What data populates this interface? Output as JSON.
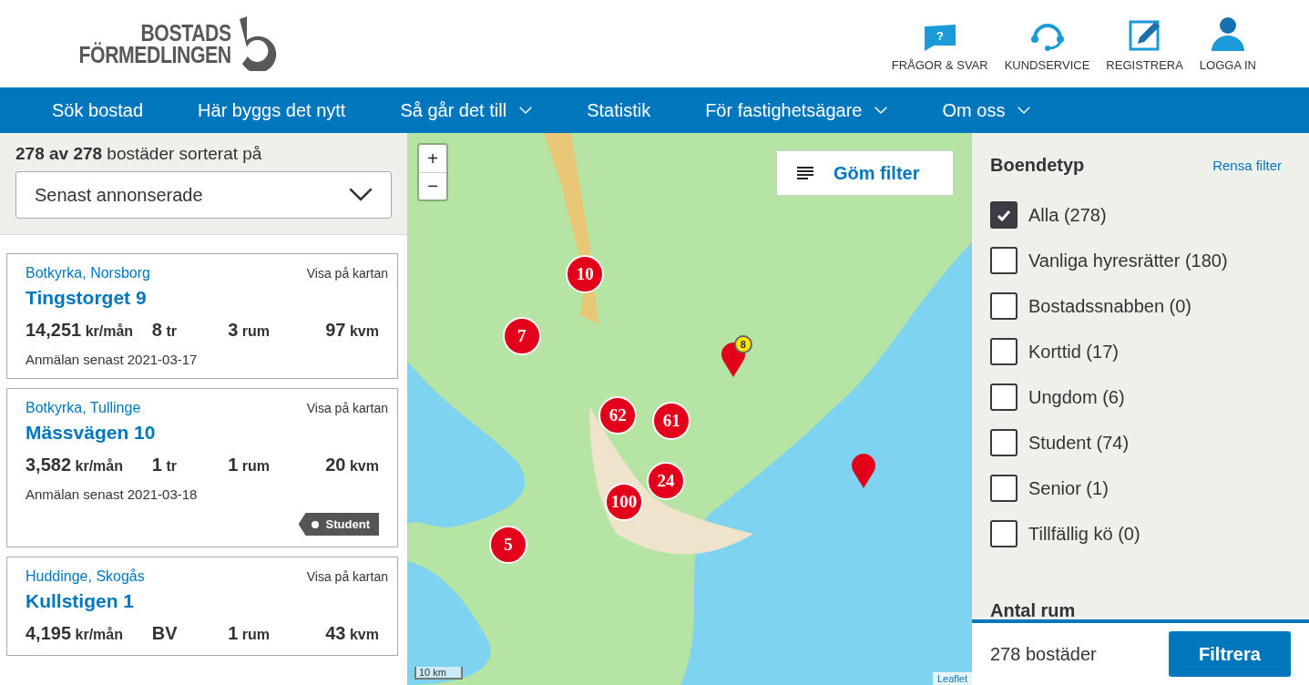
{
  "logo": {
    "lines": [
      "BOSTADS",
      "FÖRMEDLINGEN"
    ]
  },
  "top_links": [
    {
      "kind": "faq",
      "label": "FRÅGOR & SVAR",
      "icon_text": "?"
    },
    {
      "kind": "support",
      "label": "KUNDSERVICE"
    },
    {
      "kind": "register",
      "label": "REGISTRERA"
    },
    {
      "kind": "login",
      "label": "LOGGA IN"
    }
  ],
  "nav": [
    {
      "label": "Sök bostad",
      "has_menu": false
    },
    {
      "label": "Här byggs det nytt",
      "has_menu": false
    },
    {
      "label": "Så går det till",
      "has_menu": true
    },
    {
      "label": "Statistik",
      "has_menu": false
    },
    {
      "label": "För fastighetsägare",
      "has_menu": true
    },
    {
      "label": "Om oss",
      "has_menu": true
    }
  ],
  "results": {
    "summary": "**278 av 278** bostäder sorterat på",
    "sort": "Senast annonserade"
  },
  "listings": [
    {
      "area": "Botkyrka, Norsborg",
      "title": "Tingstorget 9",
      "map_link": "Visa på kartan",
      "stats": [
        {
          "value": "14,251",
          "unit": "kr/mån"
        },
        {
          "value": "8",
          "unit": "tr"
        },
        {
          "value": "3",
          "unit": "rum"
        },
        {
          "value": "97",
          "unit": "kvm"
        }
      ],
      "deadline": "Anmälan senast 2021-03-17"
    },
    {
      "area": "Botkyrka, Tullinge",
      "title": "Mässvägen 10",
      "map_link": "Visa på kartan",
      "stats": [
        {
          "value": "3,582",
          "unit": "kr/mån"
        },
        {
          "value": "1",
          "unit": "tr"
        },
        {
          "value": "1",
          "unit": "rum"
        },
        {
          "value": "20",
          "unit": "kvm"
        }
      ],
      "deadline": "Anmälan senast 2021-03-18",
      "tag": "Student"
    },
    {
      "area": "Huddinge, Skogås",
      "title": "Kullstigen 1",
      "map_link": "Visa på kartan",
      "stats": [
        {
          "value": "4,195",
          "unit": "kr/mån"
        },
        {
          "value": "BV"
        },
        {
          "value": "1",
          "unit": "rum"
        },
        {
          "value": "43",
          "unit": "kvm"
        }
      ]
    }
  ],
  "map": {
    "zoom_in": "+",
    "zoom_out": "−",
    "toggle_filter": "Göm filter",
    "scale": "10 km",
    "attribution": "Leaflet",
    "markers": [
      {
        "kind": "cluster",
        "label": "10"
      },
      {
        "kind": "cluster",
        "label": "7"
      },
      {
        "kind": "cluster",
        "label": "62"
      },
      {
        "kind": "cluster",
        "label": "61"
      },
      {
        "kind": "cluster",
        "label": "24"
      },
      {
        "kind": "cluster",
        "label": "100"
      },
      {
        "kind": "cluster",
        "label": "5"
      },
      {
        "kind": "pin",
        "label": "8"
      },
      {
        "kind": "pin"
      }
    ]
  },
  "filters": {
    "heading": "Boendetyp",
    "clear": "Rensa filter",
    "options": [
      {
        "label": "Alla (278)",
        "checked": true
      },
      {
        "label": "Vanliga hyresrätter (180)",
        "checked": false
      },
      {
        "label": "Bostadssnabben (0)",
        "checked": false
      },
      {
        "label": "Korttid (17)",
        "checked": false
      },
      {
        "label": "Ungdom (6)",
        "checked": false
      },
      {
        "label": "Student (74)",
        "checked": false
      },
      {
        "label": "Senior (1)",
        "checked": false
      },
      {
        "label": "Tillfällig kö (0)",
        "checked": false
      }
    ],
    "next_heading": "Antal rum",
    "count": "278 bostäder",
    "apply": "Filtrera"
  }
}
